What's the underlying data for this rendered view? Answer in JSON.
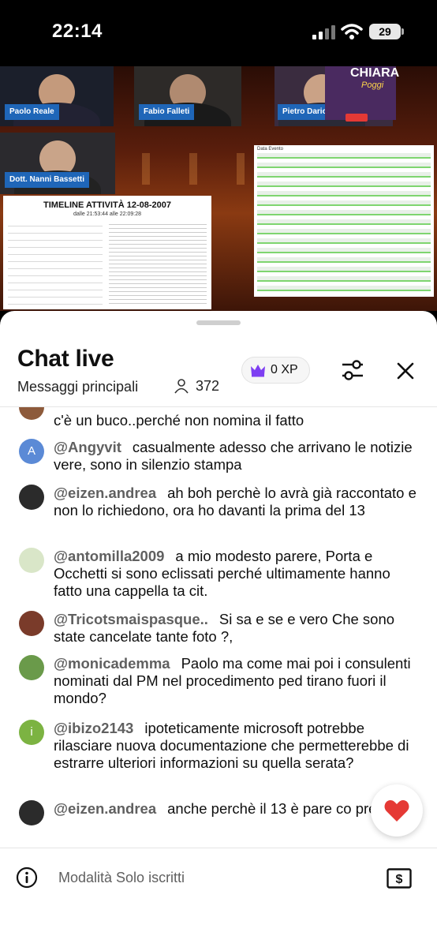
{
  "status_bar": {
    "time": "22:14",
    "battery": "29"
  },
  "video": {
    "participants": [
      {
        "name": "Paolo Reale"
      },
      {
        "name": "Fabio Falleti"
      },
      {
        "name": "Pietro Dario Quaglia"
      },
      {
        "name": "Dott. Nanni Bassetti"
      }
    ],
    "logo_text": "CHIARA",
    "logo_subtext": "Poggi",
    "document_title": "TIMELINE  ATTIVITÀ  12-08-2007",
    "document_subtitle": "dalle 21:53:44  alle 22:09:28",
    "log_header": "Data        Evento"
  },
  "chat_panel": {
    "title": "Chat live",
    "filter_label": "Messaggi principali",
    "viewer_count": "372",
    "xp_label": "0 XP",
    "messages": [
      {
        "author": "",
        "text": "c'è un buco..perché non nomina il fatto",
        "avatar_color": "#8d5a3b",
        "avatar_letter": ""
      },
      {
        "author": "@Angyvit",
        "text": "casualmente adesso che arrivano le notizie vere, sono in silenzio stampa",
        "avatar_color": "#5b8ad6",
        "avatar_letter": "A"
      },
      {
        "author": "@eizen.andrea",
        "text": "ah boh perchè lo avrà già raccontato e non lo richiedono, ora ho davanti la prima del 13",
        "avatar_color": "#2b2b2b",
        "avatar_letter": ""
      },
      {
        "author": "@antomilla2009",
        "text": "a mio modesto parere, Porta e Occhetti si sono eclissati perché ultimamente hanno fatto una cappella ta cit.",
        "avatar_color": "#d9e6c8",
        "avatar_letter": ""
      },
      {
        "author": "@Tricotsmaispasque..",
        "text": "Si sa e se e vero Che sono state cancelate tante foto ?,",
        "avatar_color": "#7a3b2a",
        "avatar_letter": ""
      },
      {
        "author": "@monicademma",
        "text": "Paolo ma come mai poi i consulenti nominati dal PM nel procedimento ped tirano fuori il mondo?",
        "avatar_color": "#6a9a4a",
        "avatar_letter": ""
      },
      {
        "author": "@ibizo2143",
        "text": "ipoteticamente microsoft potrebbe rilasciare nuova documentazione che permetterebbe di estrarre ulteriori informazioni su quella serata?",
        "avatar_color": "#7cb342",
        "avatar_letter": "i"
      },
      {
        "author": "@eizen.andrea",
        "text": "anche perchè il 13 è pare co preciso",
        "avatar_color": "#2b2b2b",
        "avatar_letter": ""
      }
    ],
    "mode_label": "Modalità Solo iscritti"
  },
  "colors": {
    "heart": "#e53935",
    "crown": "#7e3ff2",
    "nameplate": "#1f66b8"
  }
}
